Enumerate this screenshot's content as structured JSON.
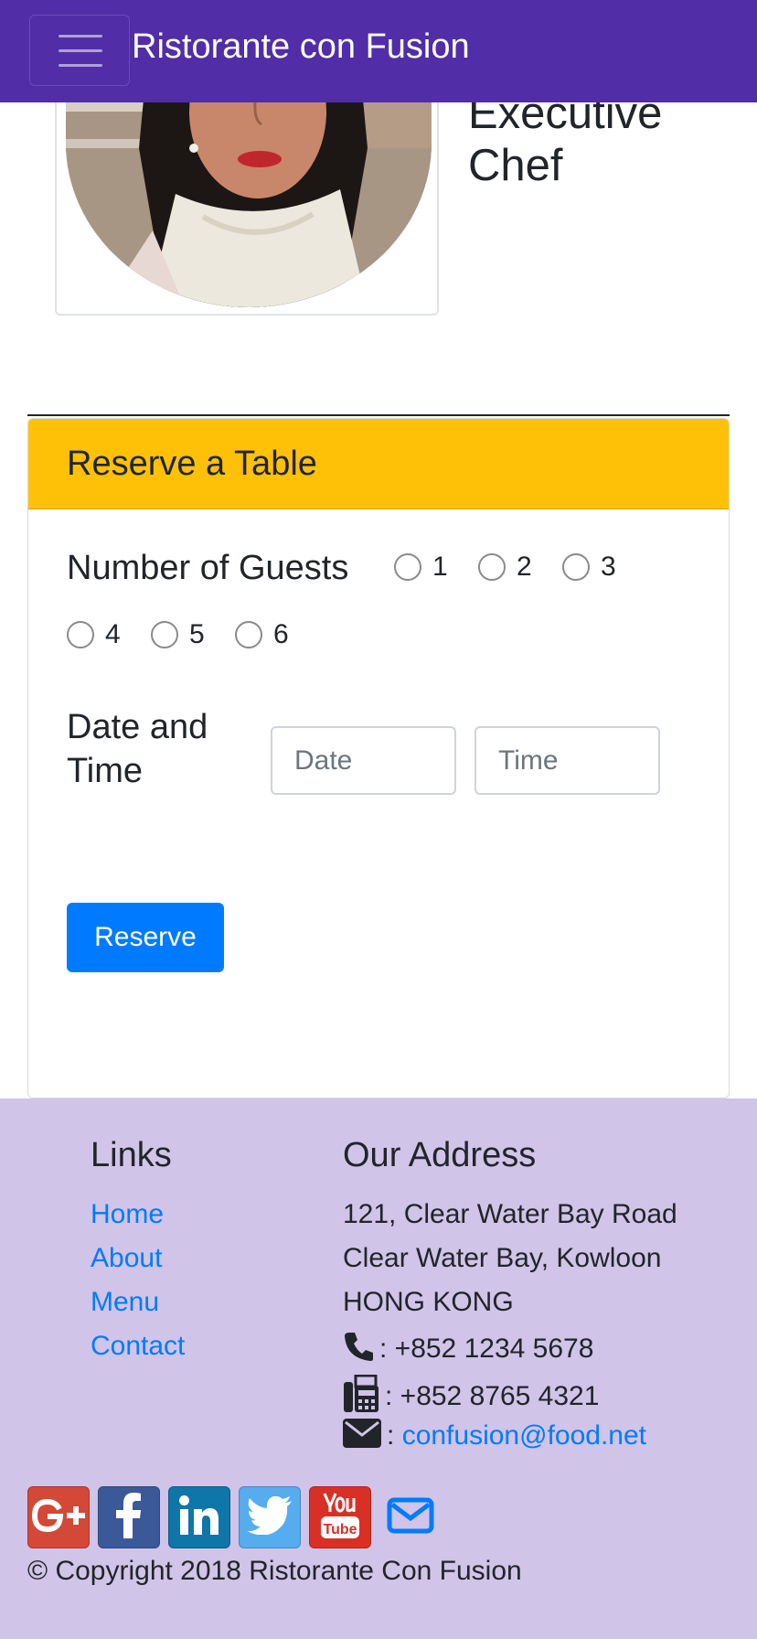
{
  "navbar": {
    "brand": "Ristorante con Fusion"
  },
  "chef": {
    "title_line1": "Executive",
    "title_line2": "Chef"
  },
  "reservation": {
    "header": "Reserve a Table",
    "guests_label": "Number of Guests",
    "guest_options": [
      "1",
      "2",
      "3",
      "4",
      "5",
      "6"
    ],
    "date_time_label_line1": "Date and",
    "date_time_label_line2": "Time",
    "date_placeholder": "Date",
    "time_placeholder": "Time",
    "submit_label": "Reserve"
  },
  "footer": {
    "links_heading": "Links",
    "links": [
      "Home",
      "About",
      "Menu",
      "Contact"
    ],
    "address_heading": "Our Address",
    "address_line1": "121, Clear Water Bay Road",
    "address_line2": "Clear Water Bay, Kowloon",
    "address_line3": "HONG KONG",
    "phone": ": +852 1234 5678",
    "fax": ": +852 8765 4321",
    "email_prefix": ":",
    "email": "confusion@food.net",
    "social_icons": [
      "google-plus-icon",
      "facebook-icon",
      "linkedin-icon",
      "twitter-icon",
      "youtube-icon",
      "mail-icon"
    ],
    "copyright": "© Copyright 2018 Ristorante Con Fusion"
  },
  "colors": {
    "navbar": "#512da8",
    "card_header": "#ffc107",
    "primary_button": "#007bff",
    "footer": "#d1c4e9",
    "google_plus": "#d34836",
    "facebook": "#3b5998",
    "linkedin": "#0e76a8",
    "twitter": "#55acee",
    "youtube": "#d93025"
  }
}
